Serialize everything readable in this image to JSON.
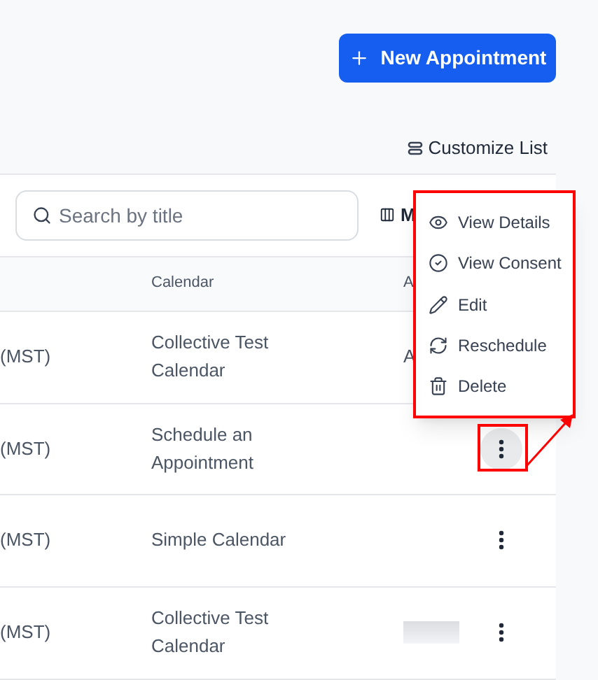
{
  "header": {
    "new_button": {
      "label": "New Appointment"
    }
  },
  "toolbar": {
    "customize_list": "Customize List",
    "search": {
      "placeholder": "Search by title"
    },
    "columns_button": "M"
  },
  "table": {
    "columns": [
      "Calendar",
      "A"
    ],
    "rows": [
      {
        "column_1": "(MST)",
        "calendar": "Collective Test Calendar",
        "column_3": "A",
        "redacted": false,
        "selected": false,
        "actions_hidden": true
      },
      {
        "column_1": "(MST)",
        "calendar": "Schedule an Appointment",
        "redacted": false,
        "selected": true
      },
      {
        "column_1": "(MST)",
        "calendar": "Simple Calendar",
        "redacted": false,
        "selected": false
      },
      {
        "column_1": "(MST)",
        "calendar": "Collective Test Calendar",
        "redacted": true,
        "selected": false
      }
    ]
  },
  "menu": {
    "items": [
      {
        "label": "View Details"
      },
      {
        "label": "View Consent"
      },
      {
        "label": "Edit"
      },
      {
        "label": "Reschedule"
      },
      {
        "label": "Delete"
      }
    ]
  }
}
